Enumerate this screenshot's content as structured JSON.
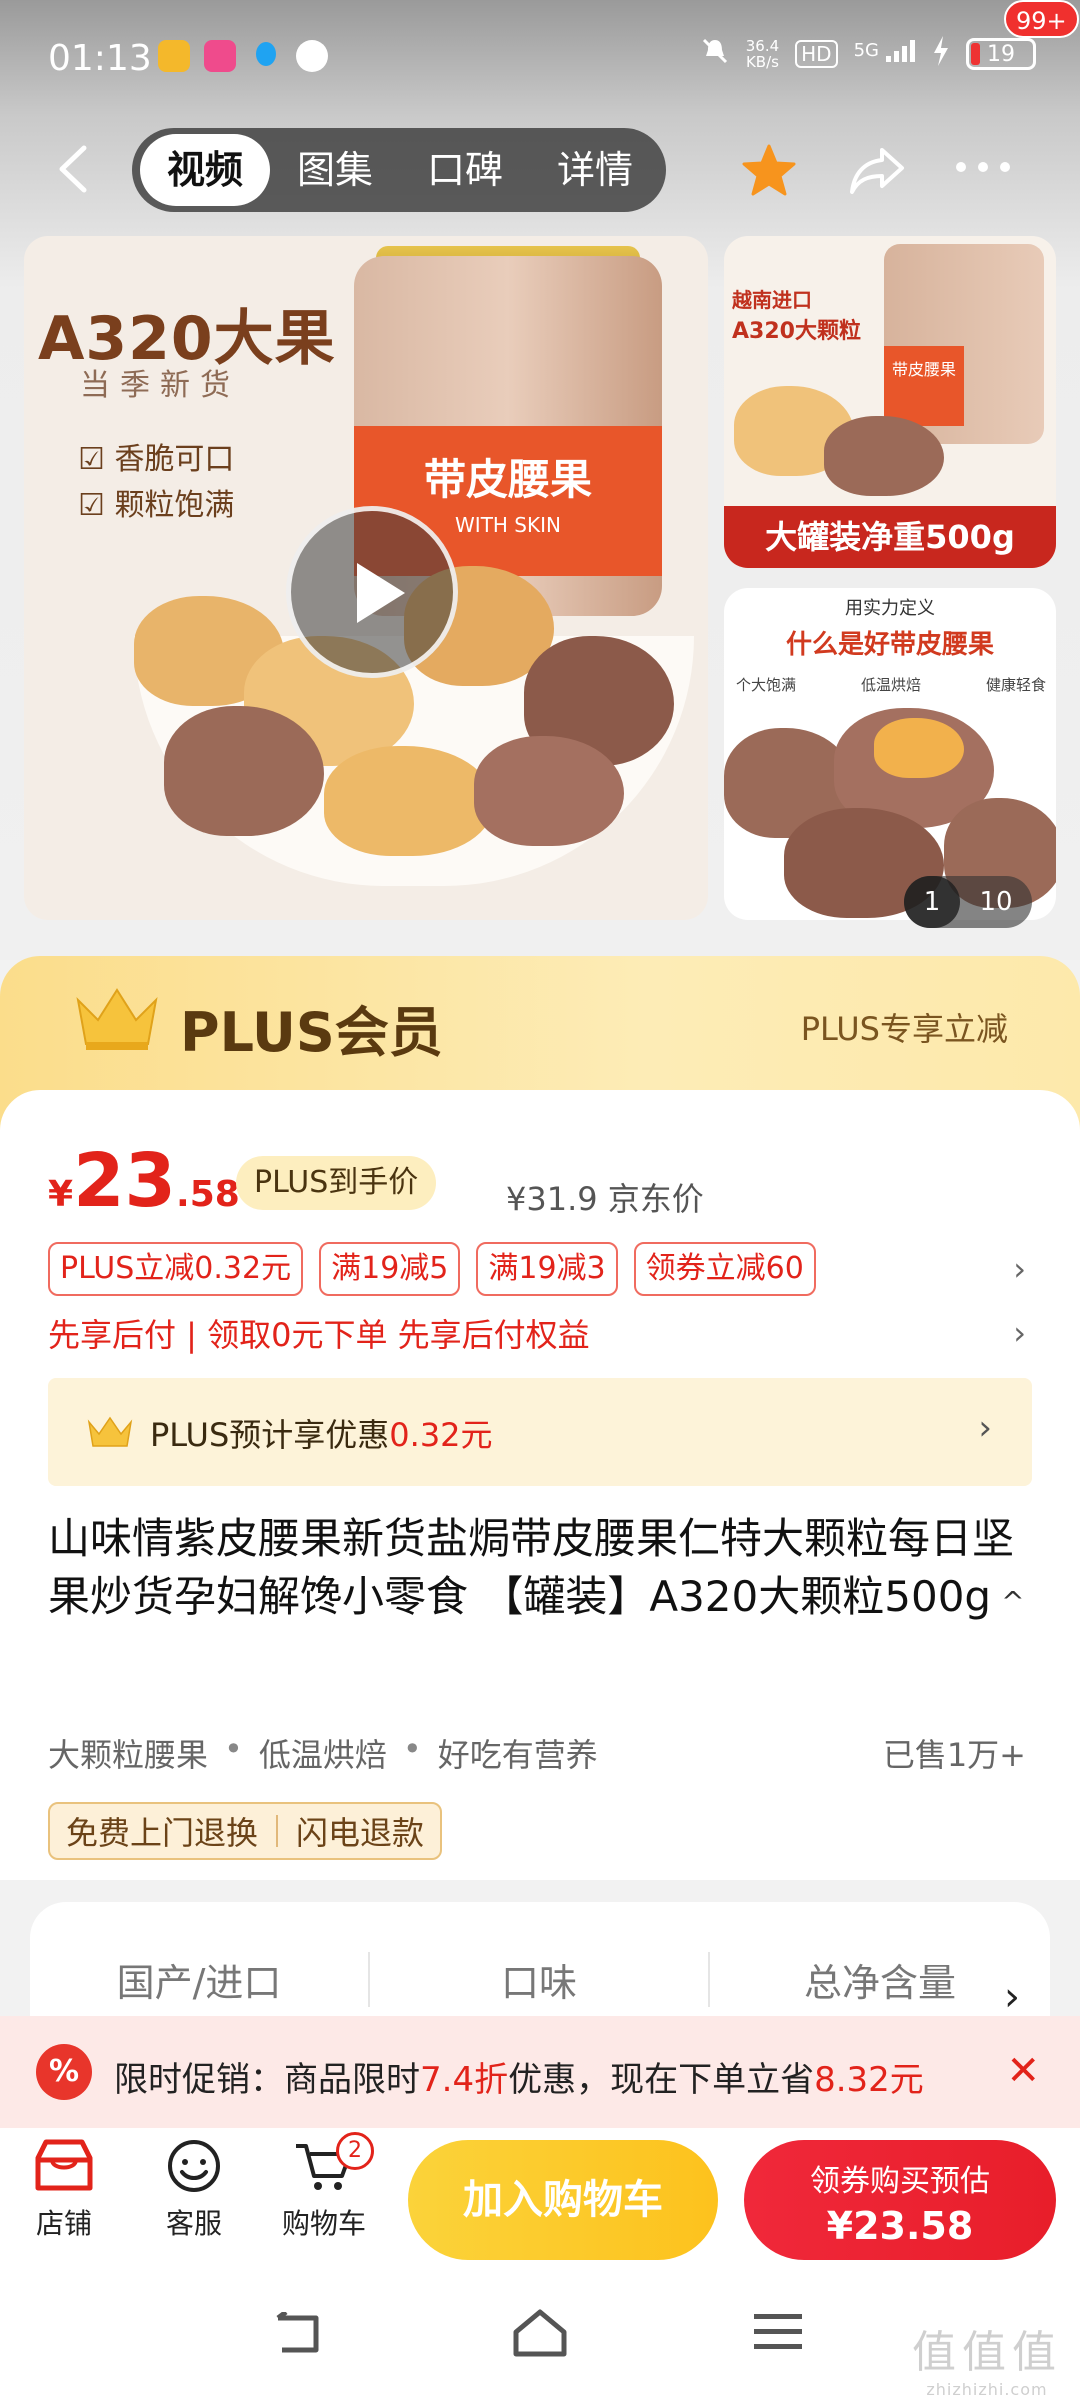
{
  "status_bar": {
    "time": "01:13",
    "net_speed_value": "36.4",
    "net_speed_unit": "KB/s",
    "hd": "HD",
    "signal": "5G",
    "battery": "19"
  },
  "nav": {
    "tabs": [
      "视频",
      "图集",
      "口碑",
      "详情"
    ],
    "active_tab": "视频",
    "badge": "99+"
  },
  "gallery": {
    "main": {
      "title": "A320大果",
      "subtitle": "当季新货",
      "checks": [
        "香脆可口",
        "颗粒饱满"
      ],
      "jar_label": "带皮腰果",
      "jar_sub": "WITH SKIN"
    },
    "side1": {
      "tag_line1": "越南进口",
      "tag_line2": "A320大颗粒",
      "jar_label": "带皮腰果",
      "band": "大罐装净重500g"
    },
    "side2": {
      "line1": "用实力定义",
      "line2": "什么是好带皮腰果",
      "features": [
        "个大饱满",
        "低温烘焙",
        "健康轻食"
      ]
    },
    "counter_current": "1",
    "counter_total": "10"
  },
  "plus_banner": {
    "title": "PLUS会员",
    "right": "PLUS专享立减"
  },
  "price": {
    "symbol": "¥",
    "integer": "23",
    "decimal": ".58",
    "plus_tag": "PLUS到手价",
    "original": "¥31.9 京东价"
  },
  "coupons": [
    "PLUS立减0.32元",
    "满19减5",
    "满19减3",
    "领券立减60"
  ],
  "pay_later": "先享后付 | 领取0元下单 先享后付权益",
  "plus_save": {
    "prefix": "PLUS预计享优惠",
    "amount": "0.32元"
  },
  "product": {
    "title": "山味情紫皮腰果新货盐焗带皮腰果仁特大颗粒每日坚果炒货孕妇解馋小零食 【罐装】A320大颗粒500g",
    "features": [
      "大颗粒腰果",
      "低温烘焙",
      "好吃有营养"
    ],
    "sold": "已售1万+",
    "services": [
      "免费上门退换",
      "闪电退款"
    ]
  },
  "spec": {
    "columns": [
      "国产/进口",
      "口味",
      "总净含量"
    ]
  },
  "promo": {
    "icon": "%",
    "text_a": "限时促销：商品限时",
    "discount": "7.4折",
    "text_b": "优惠，现在下单立省",
    "saving": "8.32元"
  },
  "bottom_bar": {
    "shop": "店铺",
    "service": "客服",
    "cart": "购物车",
    "cart_count": "2",
    "add_to_cart": "加入购物车",
    "buy_line1": "领券购买预估",
    "buy_line2": "¥23.58"
  },
  "watermark": {
    "main": "值值值",
    "sub": "zhizhizhi.com"
  },
  "colors": {
    "price_red": "#e2231a",
    "plus_gold": "#fbdd8b",
    "add_cart_yellow": "#fbd33a",
    "buy_red": "#e81e2a"
  }
}
